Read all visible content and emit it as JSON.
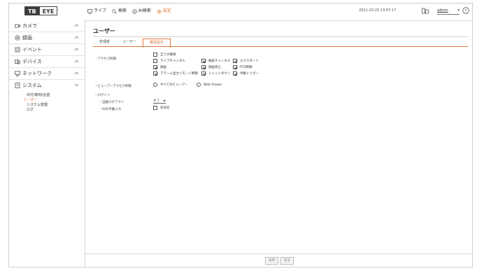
{
  "header": {
    "logo_left": "TB",
    "logo_right": "EYE",
    "nav": [
      {
        "label": "ライブ",
        "icon": "monitor-icon"
      },
      {
        "label": "検索",
        "icon": "search-icon"
      },
      {
        "label": "AI検索",
        "icon": "ai-search-icon"
      },
      {
        "label": "設定",
        "icon": "gear-icon",
        "active": true
      }
    ],
    "datetime": "2021-10-20 13:47:17",
    "user": "admin"
  },
  "sidebar": {
    "items": [
      {
        "label": "カメラ",
        "icon": "camera-icon"
      },
      {
        "label": "録画",
        "icon": "record-icon"
      },
      {
        "label": "イベント",
        "icon": "event-icon"
      },
      {
        "label": "デバイス",
        "icon": "device-icon"
      },
      {
        "label": "ネットワーク",
        "icon": "network-icon"
      },
      {
        "label": "システム",
        "icon": "system-icon"
      }
    ],
    "subitems": [
      "日付/時刻/言語",
      "ユーザー",
      "システム管理",
      "ログ"
    ]
  },
  "main": {
    "title": "ユーザー",
    "tabs": [
      "管理者",
      "ユーザー",
      "権限設定"
    ],
    "access_label": "・アクセス制限",
    "access_all": "全ての権限",
    "perms": [
      {
        "label": "ライブチャンネル",
        "checked": false
      },
      {
        "label": "検索チャンネル",
        "checked": true
      },
      {
        "label": "エクスポート",
        "checked": true
      },
      {
        "label": "録画",
        "checked": true
      },
      {
        "label": "録画停止",
        "checked": true
      },
      {
        "label": "PTZ制御",
        "checked": true
      },
      {
        "label": "アラーム出力リモート制御",
        "checked": true
      },
      {
        "label": "シャットダウン",
        "checked": true
      },
      {
        "label": "手動トリガー",
        "checked": true
      }
    ],
    "viewer_label": "・ビューアーアクセス制限",
    "viewer_options": [
      "すべてのビューアー",
      "Web Viewer"
    ],
    "login_label": "・ログイン",
    "auto_logout_label": "- 自動ログアウト",
    "auto_logout_value": "オフ",
    "manual_login_label": "- IDの手動入力",
    "manual_login_value": "有効化",
    "buttons": {
      "apply": "適用",
      "cancel": "取消"
    }
  }
}
